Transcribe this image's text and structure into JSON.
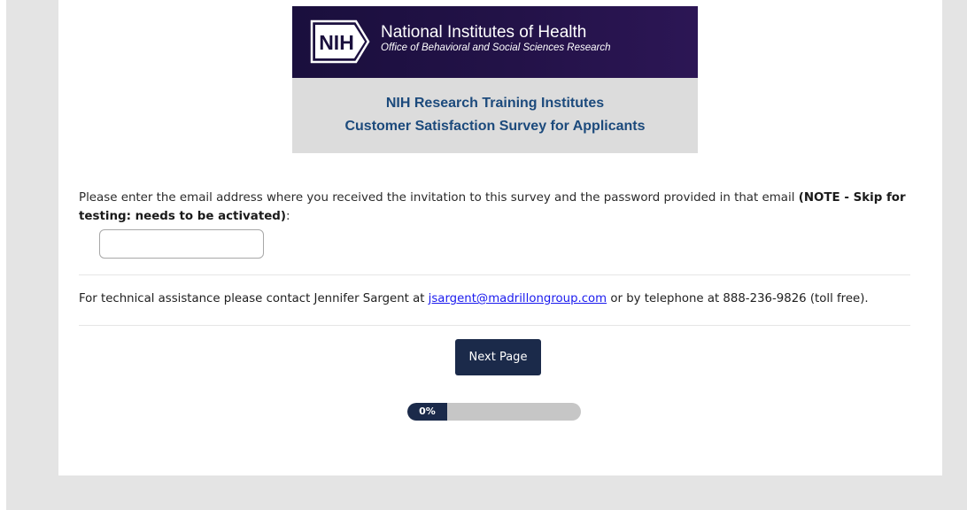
{
  "header": {
    "logo_text": "NIH",
    "org_name": "National Institutes of Health",
    "office_name": "Office of Behavioral and Social Sciences Research",
    "banner_color": "#231248",
    "title_line1": "NIH Research Training Institutes",
    "title_line2": "Customer Satisfaction Survey for Applicants",
    "title_color": "#1c4a7c"
  },
  "question": {
    "text": "Please enter the email address where you received the invitation to this survey and the password provided in that email ",
    "note": "(NOTE - Skip for testing: needs to be activated)",
    "suffix": ":",
    "input_value": "",
    "input_placeholder": ""
  },
  "tech_support": {
    "prefix": "For technical assistance please contact Jennifer Sargent at ",
    "email": "jsargent@madrillongroup.com",
    "suffix": " or by telephone at 888-236-9826 (toll free)."
  },
  "navigation": {
    "next_label": "Next Page",
    "button_color": "#1b2a4a"
  },
  "progress": {
    "label": "0%",
    "value": 0
  }
}
